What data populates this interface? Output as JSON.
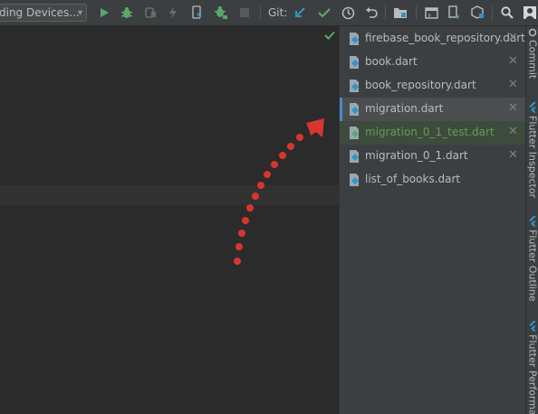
{
  "toolbar": {
    "device_selector": "ding Devices...",
    "git_label": "Git:",
    "icons": [
      "run-icon",
      "debug-icon",
      "attach-debugger-icon",
      "flutter-hot-reload-icon",
      "flutter-hot-restart-icon",
      "profile-icon",
      "stop-icon",
      "git-update-icon",
      "git-commit-icon",
      "history-icon",
      "rollback-icon",
      "project-structure-icon",
      "terminal-icon",
      "device-file-icon",
      "sdk-manager-icon",
      "search-icon",
      "avatar-icon"
    ]
  },
  "recent_files": {
    "items": [
      {
        "name": "firebase_book_repository.dart",
        "state": "normal"
      },
      {
        "name": "book.dart",
        "state": "normal"
      },
      {
        "name": "book_repository.dart",
        "state": "normal"
      },
      {
        "name": "migration.dart",
        "state": "selected"
      },
      {
        "name": "migration_0_1_test.dart",
        "state": "hover"
      },
      {
        "name": "migration_0_1.dart",
        "state": "normal"
      },
      {
        "name": "list_of_books.dart",
        "state": "normal"
      }
    ],
    "close_glyph": "✕"
  },
  "side_tabs": [
    {
      "label": "Commit"
    },
    {
      "label": "Flutter Inspector"
    },
    {
      "label": "Flutter Outline"
    },
    {
      "label": "Flutter Performa"
    }
  ],
  "colors": {
    "accent": "#4a88c7",
    "annotation": "#d9352f",
    "run": "#59a869",
    "green_text": "#6a9955"
  }
}
